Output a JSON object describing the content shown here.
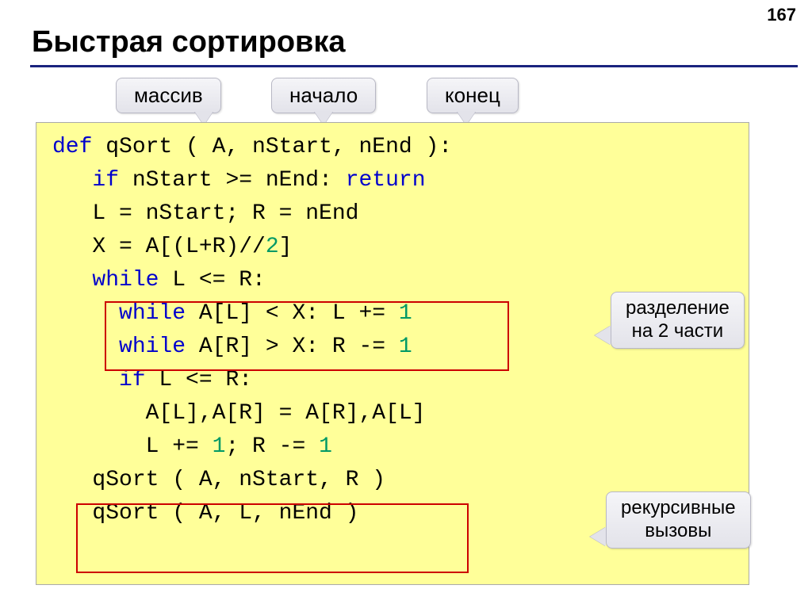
{
  "page_number": "167",
  "title": "Быстрая сортировка",
  "callouts": {
    "array": "массив",
    "start": "начало",
    "end": "конец",
    "split": "разделение\nна 2 части",
    "recursion": "рекурсивные\nвызовы"
  },
  "code": {
    "l1_def": "def",
    "l1_rest": " qSort ( A, nStart, nEnd ):",
    "l2_if": "if",
    "l2_mid": " nStart >= nEnd: ",
    "l2_return": "return",
    "l3": "   L = nStart; R = nEnd",
    "l4_a": "   X = A[(L+R)//",
    "l4_2": "2",
    "l4_b": "]",
    "l5_while": "while",
    "l5_rest": " L <= R:",
    "l6_while": "while",
    "l6_mid": " A[L] < X: L += ",
    "l6_1": "1",
    "l7_while": "while",
    "l7_mid": " A[R] > X: R -= ",
    "l7_1": "1",
    "l8_if": "if",
    "l8_rest": " L <= R:",
    "l9": "       A[L],A[R] = A[R],A[L]",
    "l10_a": "       L += ",
    "l10_1a": "1",
    "l10_b": "; R -= ",
    "l10_1b": "1",
    "l11": "   qSort ( A, nStart, R )",
    "l12": "   qSort ( A, L, nEnd )"
  }
}
